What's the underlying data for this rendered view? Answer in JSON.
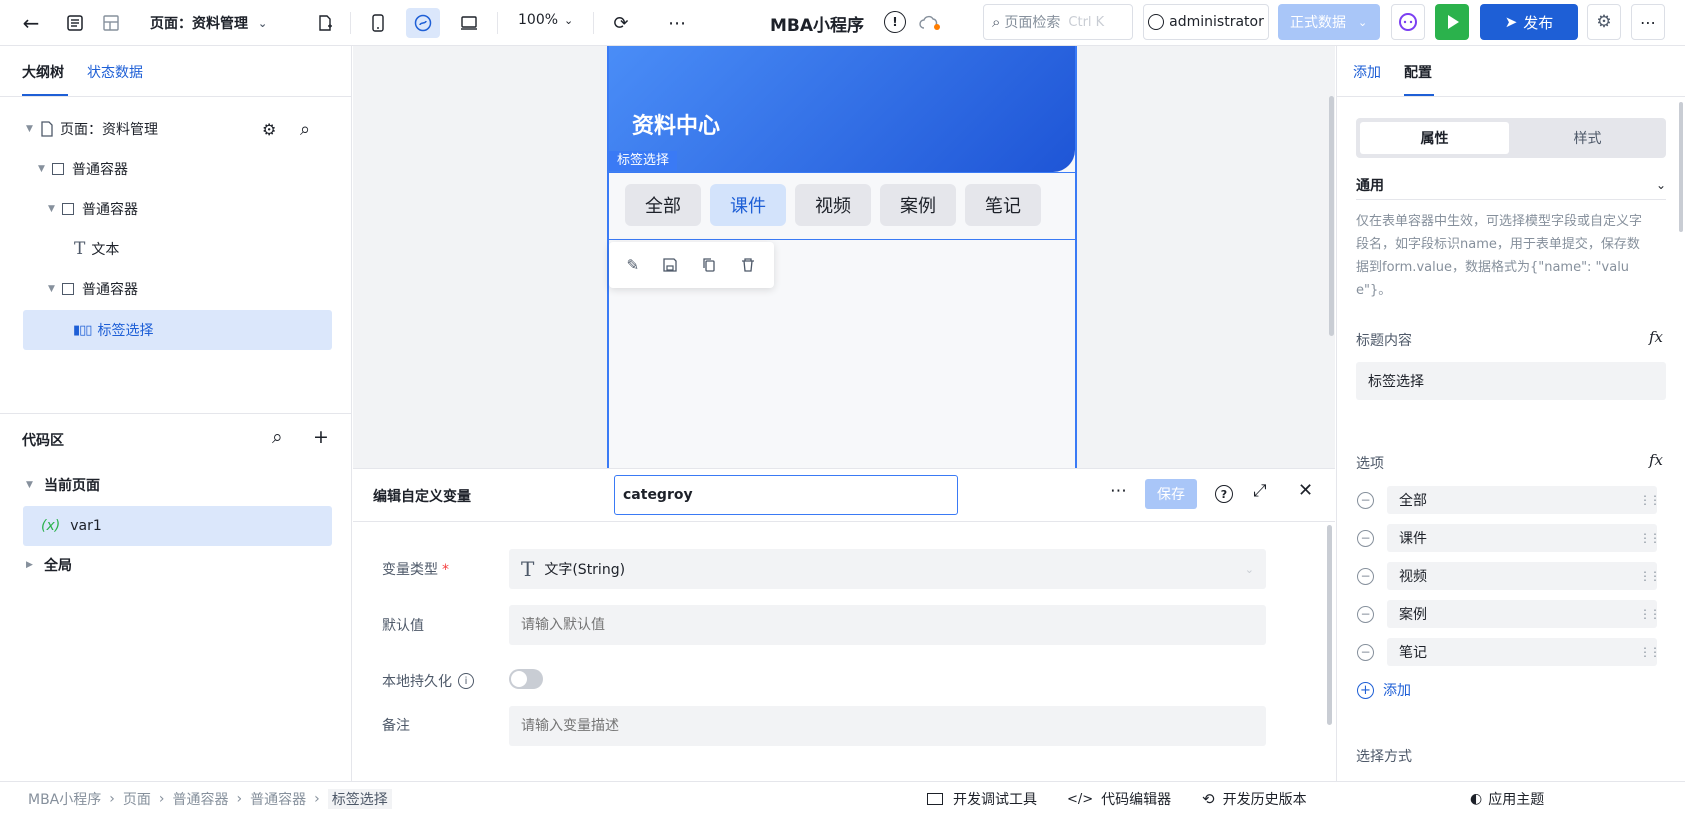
{
  "topbar": {
    "page_selector": "页面：资料管理",
    "zoom": "100%",
    "app_title": "MBA小程序",
    "search_placeholder": "页面检索",
    "search_shortcut": "Ctrl K",
    "user": "administrator",
    "env": "正式数据",
    "publish": "发布"
  },
  "left": {
    "tabs": [
      "大纲树",
      "状态数据"
    ],
    "tree": [
      {
        "label": "页面：资料管理"
      },
      {
        "label": "普通容器"
      },
      {
        "label": "普通容器"
      },
      {
        "label": "文本"
      },
      {
        "label": "普通容器"
      },
      {
        "label": "标签选择"
      }
    ],
    "code_title": "代码区",
    "code_sections": {
      "current": "当前页面",
      "var": "var1",
      "global": "全局"
    }
  },
  "canvas": {
    "header_title": "资料中心",
    "selection_tag": "标签选择",
    "tabs": [
      "全部",
      "课件",
      "视频",
      "案例",
      "笔记"
    ]
  },
  "var_editor": {
    "title": "编辑自定义变量",
    "name_value": "categroy",
    "save": "保存",
    "type_label": "变量类型",
    "type_value": "文字(String)",
    "default_label": "默认值",
    "default_placeholder": "请输入默认值",
    "persist_label": "本地持久化",
    "note_label": "备注",
    "note_placeholder": "请输入变量描述"
  },
  "right": {
    "tabs": [
      "添加",
      "配置"
    ],
    "seg": [
      "属性",
      "样式"
    ],
    "section": "通用",
    "desc": "仅在表单容器中生效，可选择模型字段或自定义字段名，如字段标识name，用于表单提交，保存数据到form.value，数据格式为{\"name\": \"value\"}。",
    "title_label": "标题内容",
    "title_value": "标签选择",
    "options_label": "选项",
    "options": [
      "全部",
      "课件",
      "视频",
      "案例",
      "笔记"
    ],
    "add": "添加",
    "partial_label": "选择方式",
    "theme": "应用主题"
  },
  "footer": {
    "breadcrumb": [
      "MBA小程序",
      "页面",
      "普通容器",
      "普通容器",
      "标签选择"
    ],
    "tools": [
      "开发调试工具",
      "代码编辑器",
      "开发历史版本"
    ]
  },
  "colors": {
    "primary": "#1e5fd6",
    "accent": "#3a7af5",
    "run": "#2bb24c",
    "selected_bg": "#dbe7fb"
  }
}
